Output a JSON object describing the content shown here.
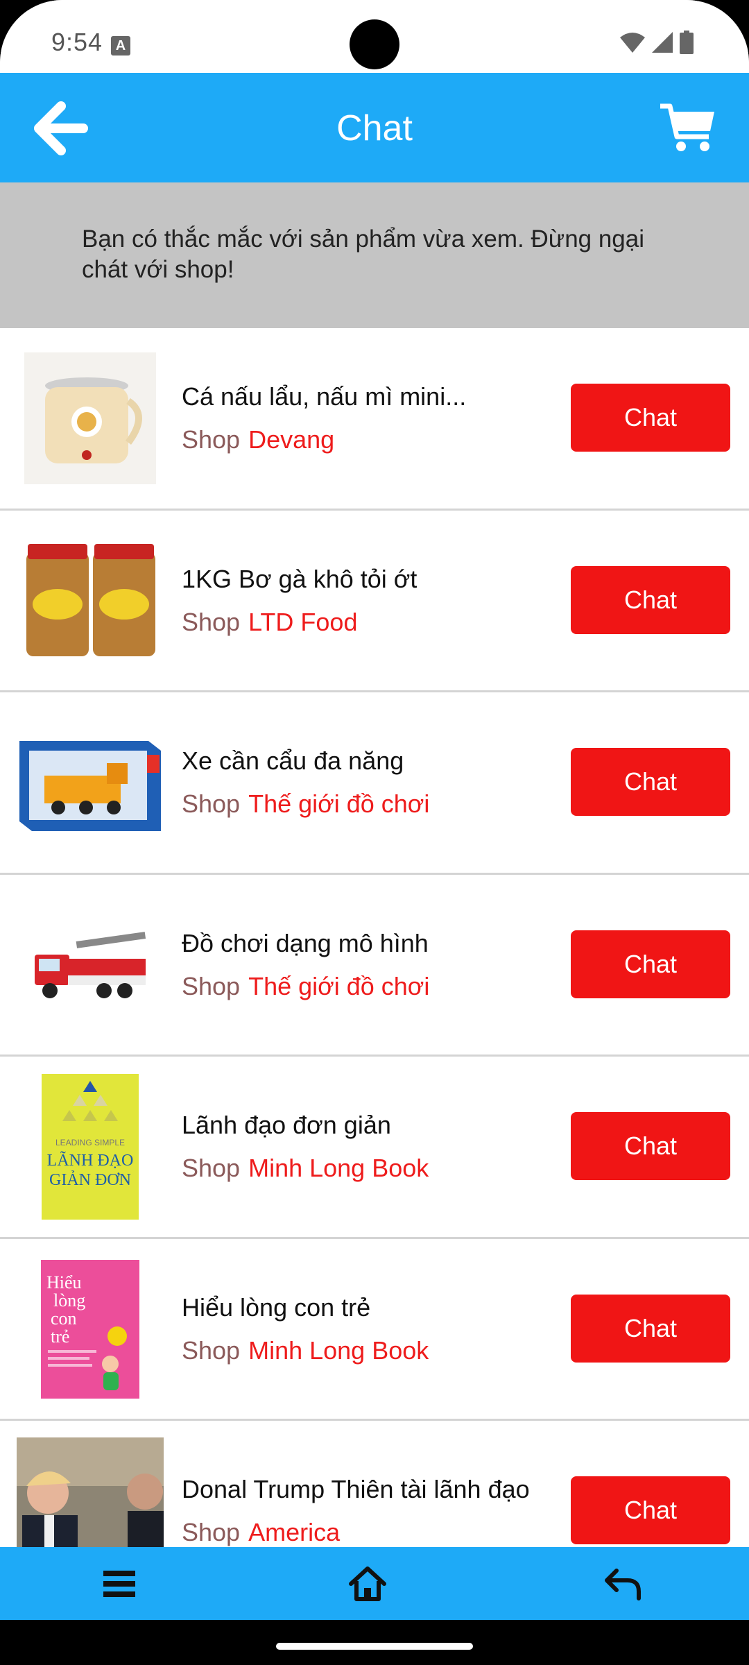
{
  "status": {
    "time": "9:54",
    "notif_letter": "A"
  },
  "header": {
    "title": "Chat"
  },
  "banner": {
    "text": "Bạn có thắc mắc với sản phẩm vừa xem. Đừng ngại chát với shop!"
  },
  "colors": {
    "primary": "#1eaaf7",
    "button": "#f01515",
    "shop_name": "#ee1c1c",
    "banner": "#c4c4c4"
  },
  "items": [
    {
      "name": "Cá nấu lẩu, nấu mì mini...",
      "shop_label": "Shop",
      "shop": "Devang",
      "chat": "Chat",
      "thumb": "kettle-image"
    },
    {
      "name": "1KG Bơ gà khô tỏi ớt",
      "shop_label": "Shop",
      "shop": "LTD Food",
      "chat": "Chat",
      "thumb": "jars-image"
    },
    {
      "name": "Xe cần cẩu đa năng",
      "shop_label": "Shop",
      "shop": "Thế giới đồ chơi",
      "chat": "Chat",
      "thumb": "crane-box-image"
    },
    {
      "name": "Đồ chơi dạng mô hình",
      "shop_label": "Shop",
      "shop": "Thế giới đồ chơi",
      "chat": "Chat",
      "thumb": "fire-truck-image"
    },
    {
      "name": "Lãnh đạo đơn giản",
      "shop_label": "Shop",
      "shop": "Minh Long Book",
      "chat": "Chat",
      "thumb": "book-cover-image",
      "cover": {
        "top": "LEADING SIMPLE",
        "title1": "LÃNH ĐẠO",
        "title2": "GIẢN ĐƠN"
      }
    },
    {
      "name": "Hiểu lòng con trẻ",
      "shop_label": "Shop",
      "shop": "Minh Long Book",
      "chat": "Chat",
      "thumb": "book-cover-image",
      "cover": {
        "title1": "Hiểu",
        "title2": "lòng",
        "title3": "con",
        "title4": "trẻ"
      }
    },
    {
      "name": "Donal Trump Thiên tài lãnh đạo",
      "shop_label": "Shop",
      "shop": "America",
      "chat": "Chat",
      "thumb": "photo-image"
    }
  ],
  "nav": {
    "menu": "menu-icon",
    "home": "home-icon",
    "back": "reply-icon"
  }
}
